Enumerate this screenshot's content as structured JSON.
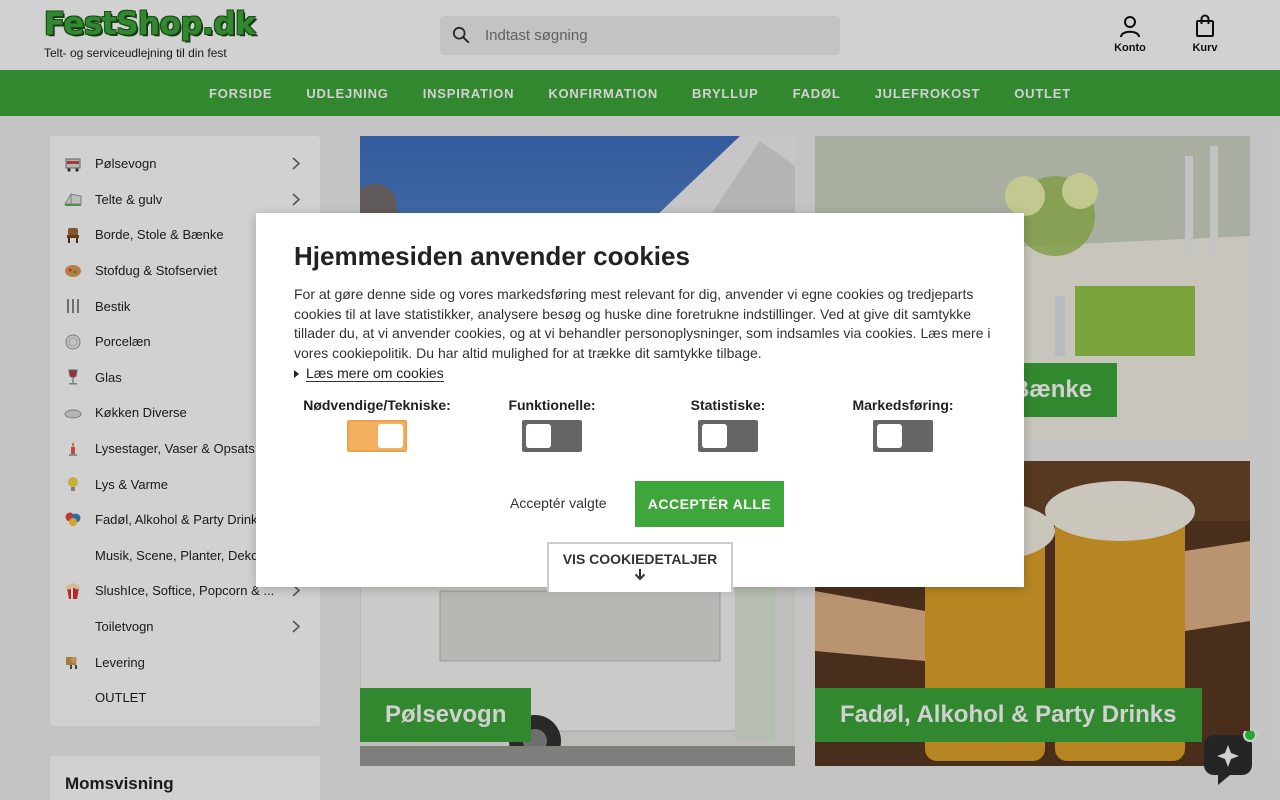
{
  "header": {
    "logo_text": "FestShop.dk",
    "tagline": "Telt- og serviceudlejning til din fest",
    "search_placeholder": "Indtast søgning",
    "account_label": "Konto",
    "cart_label": "Kurv"
  },
  "nav": {
    "items": [
      "FORSIDE",
      "UDLEJNING",
      "INSPIRATION",
      "KONFIRMATION",
      "BRYLLUP",
      "FADØL",
      "JULEFROKOST",
      "OUTLET"
    ]
  },
  "sidebar": {
    "items": [
      {
        "label": "Pølsevogn",
        "icon": "sausage-wagon-icon",
        "has_children": true
      },
      {
        "label": "Telte & gulv",
        "icon": "tent-icon",
        "has_children": true
      },
      {
        "label": "Borde, Stole & Bænke",
        "icon": "chair-icon",
        "has_children": false
      },
      {
        "label": "Stofdug & Stofserviet",
        "icon": "tablecloth-icon",
        "has_children": false
      },
      {
        "label": "Bestik",
        "icon": "cutlery-icon",
        "has_children": false
      },
      {
        "label": "Porcelæn",
        "icon": "plate-icon",
        "has_children": false
      },
      {
        "label": "Glas",
        "icon": "wine-glass-icon",
        "has_children": false
      },
      {
        "label": "Køkken Diverse",
        "icon": "kitchen-icon",
        "has_children": false
      },
      {
        "label": "Lysestager, Vaser & Opsats",
        "icon": "candle-icon",
        "has_children": false
      },
      {
        "label": "Lys & Varme",
        "icon": "bulb-icon",
        "has_children": false
      },
      {
        "label": "Fadøl, Alkohol & Party Drinks",
        "icon": "balloons-icon",
        "has_children": false
      },
      {
        "label": "Musik, Scene, Planter, Dekoration",
        "icon": "",
        "has_children": false
      },
      {
        "label": "SlushIce, Softice, Popcorn & ...",
        "icon": "popcorn-icon",
        "has_children": true
      },
      {
        "label": "Toiletvogn",
        "icon": "",
        "has_children": true
      },
      {
        "label": "Levering",
        "icon": "delivery-icon",
        "has_children": false
      },
      {
        "label": "OUTLET",
        "icon": "",
        "has_children": false
      }
    ],
    "moms_title": "Momsvisning"
  },
  "tiles": {
    "bottom_left": "Pølsevogn",
    "top_right": "Borde, Stole & Bænke",
    "bottom_right": "Fadøl, Alkohol & Party Drinks"
  },
  "cookie": {
    "title": "Hjemmesiden anvender cookies",
    "text": "For at gøre denne side og vores markedsføring mest relevant for dig, anvender vi egne cookies og tredjeparts cookies til at lave statistikker, analysere besøg og huske dine foretrukne indstillinger. Ved at give dit samtykke tillader du, at vi anvender cookies, og at vi behandler personoplysninger, som indsamles via cookies. Læs mere i vores cookiepolitik. Du har altid mulighed for at trække dit samtykke tilbage.",
    "read_more": "Læs mere om cookies",
    "categories": [
      {
        "label": "Nødvendige/Tekniske:",
        "enabled": true
      },
      {
        "label": "Funktionelle:",
        "enabled": false
      },
      {
        "label": "Statistiske:",
        "enabled": false
      },
      {
        "label": "Markedsføring:",
        "enabled": false
      }
    ],
    "accept_selected": "Acceptér valgte",
    "accept_all": "ACCEPTÉR ALLE",
    "show_details": "VIS COOKIEDETALJER"
  },
  "colors": {
    "brand_green": "#3ea63a",
    "toggle_on": "#f3b060",
    "toggle_off": "#666666"
  }
}
